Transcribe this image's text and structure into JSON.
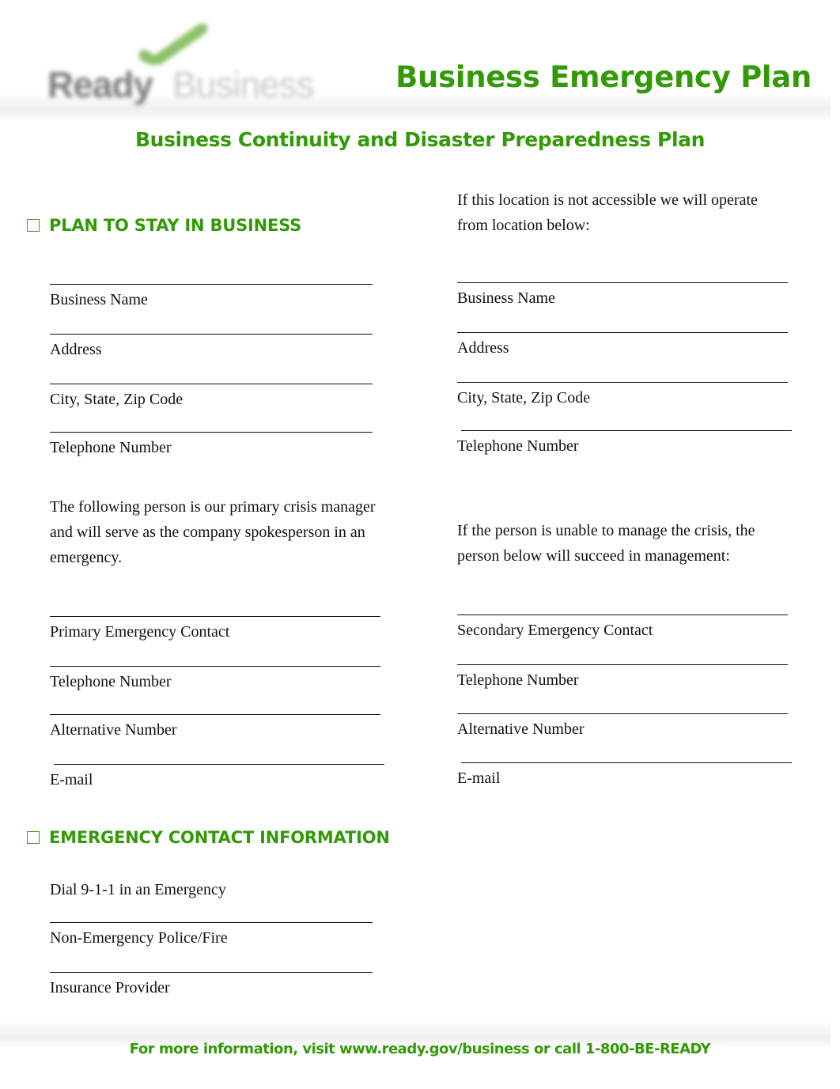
{
  "header": {
    "logo": {
      "word1": "Ready",
      "word2": "Business",
      "icon": "checkmark-icon"
    },
    "title": "Business Emergency Plan",
    "subtitle": "Business Continuity and Disaster Preparedness Plan"
  },
  "colors": {
    "brand_green": "#339a07",
    "logo_check_green": "#8cc26a"
  },
  "plan_section": {
    "heading": "PLAN TO STAY IN BUSINESS",
    "primary_location": {
      "fields": [
        "Business Name",
        "Address",
        "City, State, Zip Code",
        "Telephone Number"
      ]
    },
    "alternate_location": {
      "intro": "If this location is not accessible we will operate from location below:",
      "fields": [
        "Business Name",
        "Address",
        "City, State, Zip Code",
        "Telephone Number"
      ]
    },
    "primary_contact": {
      "intro": "The following person is our primary crisis manager and will serve as the company spokesperson in an emergency.",
      "fields": [
        "Primary Emergency Contact",
        "Telephone Number",
        "Alternative Number",
        "E-mail"
      ]
    },
    "secondary_contact": {
      "intro": "If the person is unable to manage the crisis, the person below will succeed in management:",
      "fields": [
        "Secondary Emergency Contact",
        "Telephone Number",
        "Alternative Number",
        "E-mail"
      ]
    }
  },
  "emergency_section": {
    "heading": "EMERGENCY CONTACT INFORMATION",
    "static_line": "Dial 9-1-1 in an Emergency",
    "fields": [
      "Non-Emergency Police/Fire",
      "Insurance Provider"
    ]
  },
  "footer": {
    "text": "For more information, visit www.ready.gov/business or call 1-800-BE-READY"
  }
}
